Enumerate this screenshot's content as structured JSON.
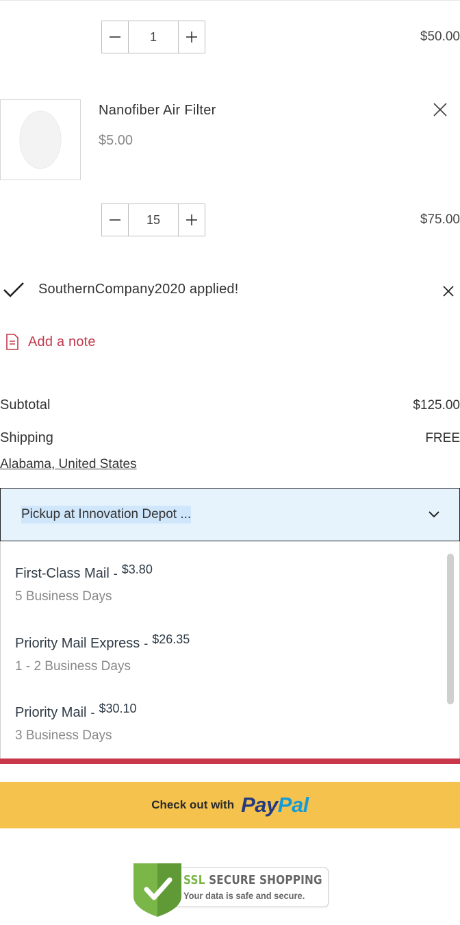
{
  "cart": {
    "items": [
      {
        "quantity": "1",
        "line_total": "$50.00"
      },
      {
        "title": "Nanofiber Air Filter",
        "unit_price": "$5.00",
        "quantity": "15",
        "line_total": "$75.00"
      }
    ],
    "icons": {
      "minus": "minus-icon",
      "plus": "plus-icon",
      "remove": "close-icon"
    }
  },
  "coupon": {
    "text": "SouthernCompany2020 applied!"
  },
  "note": {
    "label": "Add a note"
  },
  "summary": {
    "subtotal_label": "Subtotal",
    "subtotal_value": "$125.00",
    "shipping_label": "Shipping",
    "shipping_value": "FREE",
    "region": "Alabama, United States"
  },
  "shipping_select": {
    "selected": "Pickup at Innovation Depot ...",
    "options": [
      {
        "name": "First-Class Mail",
        "dash": "-",
        "price": "$3.80",
        "days": "5 Business Days"
      },
      {
        "name": "Priority Mail Express",
        "dash": "-",
        "price": "$26.35",
        "days": "1 - 2 Business Days"
      },
      {
        "name": "Priority Mail",
        "dash": "-",
        "price": "$30.10",
        "days": "3 Business Days"
      }
    ]
  },
  "paypal": {
    "prefix": "Check out with",
    "logo_a": "Pay",
    "logo_b": "Pal"
  },
  "ssl_badge": {
    "ssl": "SSL",
    "title": "SECURE SHOPPING",
    "subtitle": "Your data is safe and secure."
  },
  "colors": {
    "accent_red": "#c8374a",
    "paypal_yellow": "#f5c24e",
    "select_bg": "#e6f3fd"
  }
}
